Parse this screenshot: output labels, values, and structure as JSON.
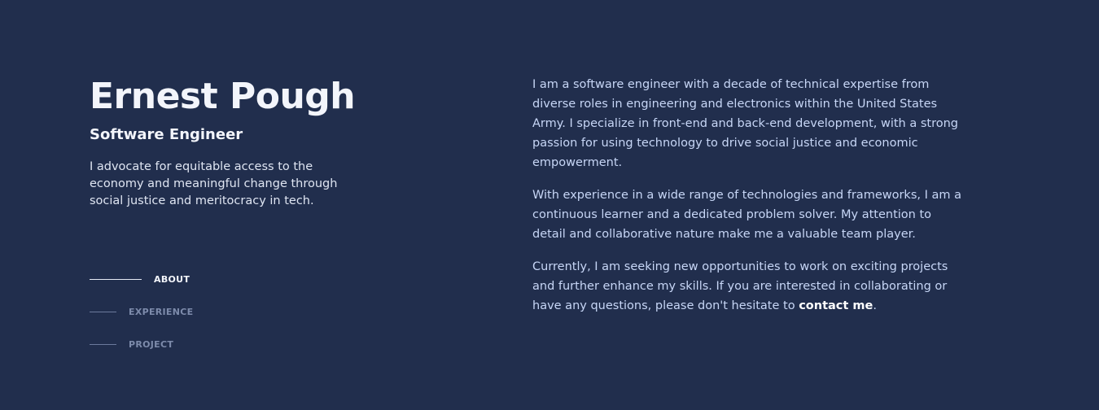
{
  "profile": {
    "name": "Ernest Pough",
    "title": "Software Engineer",
    "tagline": "I advocate for equitable access to the economy and meaningful change through social justice and meritocracy in tech."
  },
  "nav": {
    "items": [
      {
        "label": "ABOUT",
        "active": true
      },
      {
        "label": "EXPERIENCE",
        "active": false
      },
      {
        "label": "PROJECT",
        "active": false
      }
    ]
  },
  "about": {
    "paragraph_1": "I am a software engineer with a decade of technical expertise from diverse roles in engineering and electronics within the United States Army. I specialize in front-end and back-end development, with a strong passion for using technology to drive social justice and economic empowerment.",
    "paragraph_2": "With experience in a wide range of technologies and frameworks, I am a continuous learner and a dedicated problem solver. My attention to detail and collaborative nature make me a valuable team player.",
    "paragraph_3_before_link": "Currently, I am seeking new opportunities to work on exciting projects and further enhance my skills. If you are interested in collaborating or have any questions, please don't hesitate to ",
    "contact_link": "contact me",
    "paragraph_3_after_link": "."
  },
  "colors": {
    "background": "#212e4d",
    "heading": "#f3f5fb",
    "body_text": "#c7d6f6",
    "nav_inactive": "#7d8bab"
  }
}
